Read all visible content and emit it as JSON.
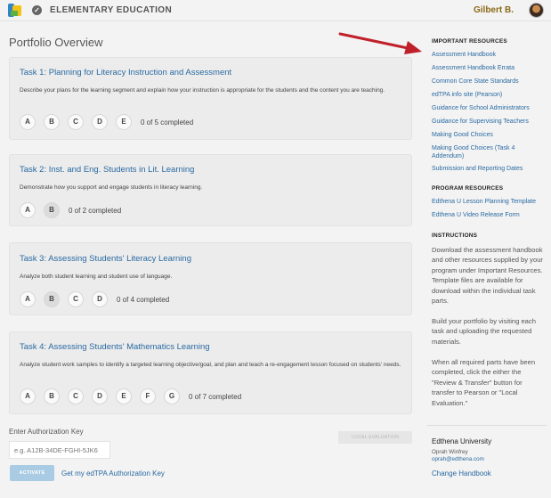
{
  "header": {
    "app_title": "ELEMENTARY EDUCATION",
    "user_name": "Gilbert B."
  },
  "main": {
    "title": "Portfolio Overview",
    "tasks": [
      {
        "title": "Task 1: Planning for Literacy Instruction and Assessment",
        "description": "Describe your plans for the learning segment and explain how your instruction is appropriate for the students and the content you are teaching.",
        "parts": [
          "A",
          "B",
          "C",
          "D",
          "E"
        ],
        "completed": [],
        "status": "0 of 5 completed"
      },
      {
        "title": "Task 2: Inst. and Eng. Students in Lit. Learning",
        "description": "Demonstrate how you support and engage students in literacy learning.",
        "parts": [
          "A",
          "B"
        ],
        "completed": [
          "B"
        ],
        "status": "0 of 2 completed"
      },
      {
        "title": "Task 3: Assessing Students' Literacy Learning",
        "description": "Analyze both student learning and student use of language.",
        "parts": [
          "A",
          "B",
          "C",
          "D"
        ],
        "completed": [
          "B"
        ],
        "status": "0 of 4 completed"
      },
      {
        "title": "Task 4: Assessing Students' Mathematics Learning",
        "description": "Analyze student work samples to identify a targeted learning objective/goal, and plan and teach a re-engagement lesson focused on students' needs.",
        "parts": [
          "A",
          "B",
          "C",
          "D",
          "E",
          "F",
          "G"
        ],
        "completed": [],
        "status": "0 of 7 completed"
      }
    ],
    "auth": {
      "label": "Enter Authorization Key",
      "placeholder": "e.g. A12B-34DE-FGHI-5JK6",
      "local_button": "LOCAL EVALUATION",
      "activate_button": "ACTIVATE",
      "get_key_link": "Get my edTPA Authorization Key"
    }
  },
  "sidebar": {
    "important_heading": "IMPORTANT RESOURCES",
    "important_links": [
      "Assessment Handbook",
      "Assessment Handbook Errata",
      "Common Core State Standards",
      "edTPA info site (Pearson)",
      "Guidance for School Administrators",
      "Guidance for Supervising Teachers",
      "Making Good Choices",
      "Making Good Choices (Task 4 Addendum)",
      "Submission and Reporting Dates"
    ],
    "program_heading": "PROGRAM RESOURCES",
    "program_links": [
      "Edthena U Lesson Planning Template",
      "Edthena U Video Release Form"
    ],
    "instructions_heading": "INSTRUCTIONS",
    "instructions": [
      "Download the assessment handbook and other resources supplied by your program under Important Resources. Template files are available for download within the individual task parts.",
      "Build your portfolio by visiting each task and uploading the requested materials.",
      "When all required parts have been completed, click the either the \"Review & Transfer\" button for transfer to Pearson or \"Local Evaluation.\""
    ],
    "university": {
      "name": "Edthena University",
      "contact_name": "Oprah Winfrey",
      "contact_email": "oprah@edthena.com",
      "handbook_link": "Change Handbook"
    }
  },
  "colors": {
    "link": "#2a6aa2",
    "user_name": "#8a6a17",
    "arrow": "#c0202a",
    "activate_button": "#a9cbe3"
  }
}
